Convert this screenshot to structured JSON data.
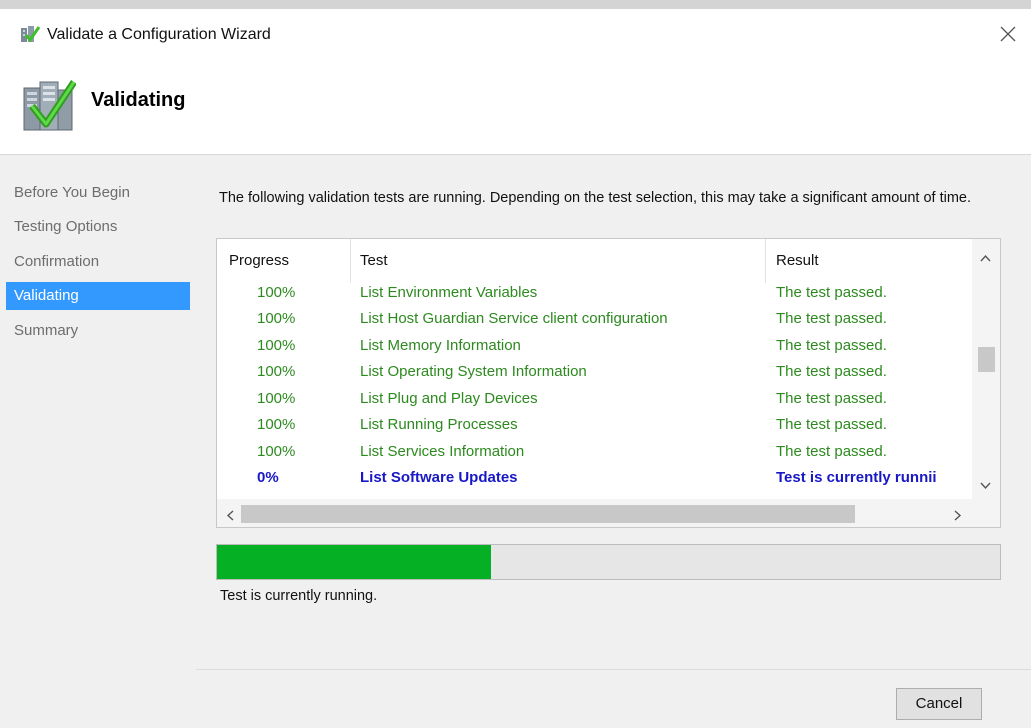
{
  "window": {
    "title": "Validate a Configuration Wizard",
    "close_icon": "close-icon"
  },
  "header": {
    "title": "Validating",
    "icon": "validation-checkmark-icon"
  },
  "nav": {
    "items": [
      {
        "label": "Before You Begin",
        "active": false
      },
      {
        "label": "Testing Options",
        "active": false
      },
      {
        "label": "Confirmation",
        "active": false
      },
      {
        "label": "Validating",
        "active": true
      },
      {
        "label": "Summary",
        "active": false
      }
    ]
  },
  "content": {
    "intro": "The following validation tests are running. Depending on the test selection, this may take a significant amount of time.",
    "table": {
      "columns": [
        "Progress",
        "Test",
        "Result"
      ],
      "rows": [
        {
          "progress": "100%",
          "test": "List Environment Variables",
          "result": "The test passed.",
          "state": "passed"
        },
        {
          "progress": "100%",
          "test": "List Host Guardian Service client configuration",
          "result": "The test passed.",
          "state": "passed"
        },
        {
          "progress": "100%",
          "test": "List Memory Information",
          "result": "The test passed.",
          "state": "passed"
        },
        {
          "progress": "100%",
          "test": "List Operating System Information",
          "result": "The test passed.",
          "state": "passed"
        },
        {
          "progress": "100%",
          "test": "List Plug and Play Devices",
          "result": "The test passed.",
          "state": "passed"
        },
        {
          "progress": "100%",
          "test": "List Running Processes",
          "result": "The test passed.",
          "state": "passed"
        },
        {
          "progress": "100%",
          "test": "List Services Information",
          "result": "The test passed.",
          "state": "passed"
        },
        {
          "progress": "0%",
          "test": "List Software Updates",
          "result": "Test is currently runnii",
          "state": "running"
        }
      ]
    },
    "progress_fraction": 0.35,
    "status": "Test is currently running.",
    "cancel_label": "Cancel"
  },
  "colors": {
    "passed": "#2d8a1f",
    "running": "#1818c8",
    "nav_active": "#3399ff",
    "progress_fill": "#06b025"
  }
}
